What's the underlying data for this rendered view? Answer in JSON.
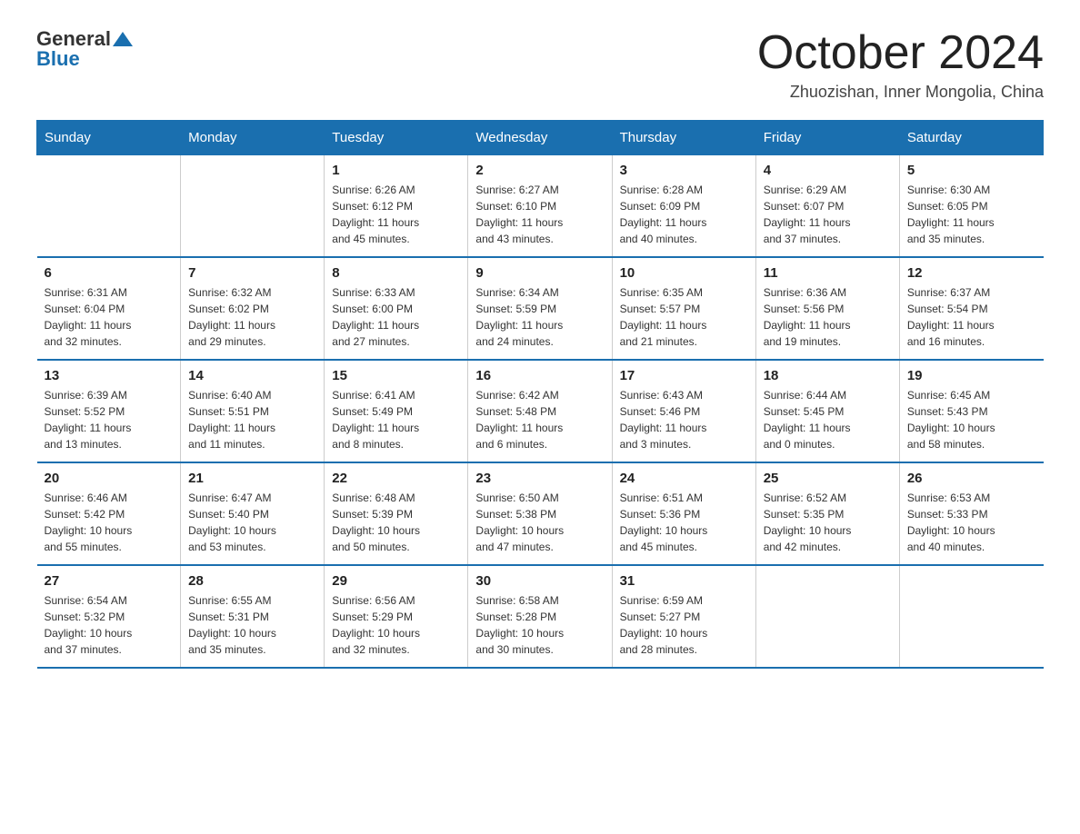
{
  "logo": {
    "general": "General",
    "blue": "Blue"
  },
  "header": {
    "month_year": "October 2024",
    "location": "Zhuozishan, Inner Mongolia, China"
  },
  "days_of_week": [
    "Sunday",
    "Monday",
    "Tuesday",
    "Wednesday",
    "Thursday",
    "Friday",
    "Saturday"
  ],
  "weeks": [
    [
      {
        "day": "",
        "info": ""
      },
      {
        "day": "",
        "info": ""
      },
      {
        "day": "1",
        "info": "Sunrise: 6:26 AM\nSunset: 6:12 PM\nDaylight: 11 hours\nand 45 minutes."
      },
      {
        "day": "2",
        "info": "Sunrise: 6:27 AM\nSunset: 6:10 PM\nDaylight: 11 hours\nand 43 minutes."
      },
      {
        "day": "3",
        "info": "Sunrise: 6:28 AM\nSunset: 6:09 PM\nDaylight: 11 hours\nand 40 minutes."
      },
      {
        "day": "4",
        "info": "Sunrise: 6:29 AM\nSunset: 6:07 PM\nDaylight: 11 hours\nand 37 minutes."
      },
      {
        "day": "5",
        "info": "Sunrise: 6:30 AM\nSunset: 6:05 PM\nDaylight: 11 hours\nand 35 minutes."
      }
    ],
    [
      {
        "day": "6",
        "info": "Sunrise: 6:31 AM\nSunset: 6:04 PM\nDaylight: 11 hours\nand 32 minutes."
      },
      {
        "day": "7",
        "info": "Sunrise: 6:32 AM\nSunset: 6:02 PM\nDaylight: 11 hours\nand 29 minutes."
      },
      {
        "day": "8",
        "info": "Sunrise: 6:33 AM\nSunset: 6:00 PM\nDaylight: 11 hours\nand 27 minutes."
      },
      {
        "day": "9",
        "info": "Sunrise: 6:34 AM\nSunset: 5:59 PM\nDaylight: 11 hours\nand 24 minutes."
      },
      {
        "day": "10",
        "info": "Sunrise: 6:35 AM\nSunset: 5:57 PM\nDaylight: 11 hours\nand 21 minutes."
      },
      {
        "day": "11",
        "info": "Sunrise: 6:36 AM\nSunset: 5:56 PM\nDaylight: 11 hours\nand 19 minutes."
      },
      {
        "day": "12",
        "info": "Sunrise: 6:37 AM\nSunset: 5:54 PM\nDaylight: 11 hours\nand 16 minutes."
      }
    ],
    [
      {
        "day": "13",
        "info": "Sunrise: 6:39 AM\nSunset: 5:52 PM\nDaylight: 11 hours\nand 13 minutes."
      },
      {
        "day": "14",
        "info": "Sunrise: 6:40 AM\nSunset: 5:51 PM\nDaylight: 11 hours\nand 11 minutes."
      },
      {
        "day": "15",
        "info": "Sunrise: 6:41 AM\nSunset: 5:49 PM\nDaylight: 11 hours\nand 8 minutes."
      },
      {
        "day": "16",
        "info": "Sunrise: 6:42 AM\nSunset: 5:48 PM\nDaylight: 11 hours\nand 6 minutes."
      },
      {
        "day": "17",
        "info": "Sunrise: 6:43 AM\nSunset: 5:46 PM\nDaylight: 11 hours\nand 3 minutes."
      },
      {
        "day": "18",
        "info": "Sunrise: 6:44 AM\nSunset: 5:45 PM\nDaylight: 11 hours\nand 0 minutes."
      },
      {
        "day": "19",
        "info": "Sunrise: 6:45 AM\nSunset: 5:43 PM\nDaylight: 10 hours\nand 58 minutes."
      }
    ],
    [
      {
        "day": "20",
        "info": "Sunrise: 6:46 AM\nSunset: 5:42 PM\nDaylight: 10 hours\nand 55 minutes."
      },
      {
        "day": "21",
        "info": "Sunrise: 6:47 AM\nSunset: 5:40 PM\nDaylight: 10 hours\nand 53 minutes."
      },
      {
        "day": "22",
        "info": "Sunrise: 6:48 AM\nSunset: 5:39 PM\nDaylight: 10 hours\nand 50 minutes."
      },
      {
        "day": "23",
        "info": "Sunrise: 6:50 AM\nSunset: 5:38 PM\nDaylight: 10 hours\nand 47 minutes."
      },
      {
        "day": "24",
        "info": "Sunrise: 6:51 AM\nSunset: 5:36 PM\nDaylight: 10 hours\nand 45 minutes."
      },
      {
        "day": "25",
        "info": "Sunrise: 6:52 AM\nSunset: 5:35 PM\nDaylight: 10 hours\nand 42 minutes."
      },
      {
        "day": "26",
        "info": "Sunrise: 6:53 AM\nSunset: 5:33 PM\nDaylight: 10 hours\nand 40 minutes."
      }
    ],
    [
      {
        "day": "27",
        "info": "Sunrise: 6:54 AM\nSunset: 5:32 PM\nDaylight: 10 hours\nand 37 minutes."
      },
      {
        "day": "28",
        "info": "Sunrise: 6:55 AM\nSunset: 5:31 PM\nDaylight: 10 hours\nand 35 minutes."
      },
      {
        "day": "29",
        "info": "Sunrise: 6:56 AM\nSunset: 5:29 PM\nDaylight: 10 hours\nand 32 minutes."
      },
      {
        "day": "30",
        "info": "Sunrise: 6:58 AM\nSunset: 5:28 PM\nDaylight: 10 hours\nand 30 minutes."
      },
      {
        "day": "31",
        "info": "Sunrise: 6:59 AM\nSunset: 5:27 PM\nDaylight: 10 hours\nand 28 minutes."
      },
      {
        "day": "",
        "info": ""
      },
      {
        "day": "",
        "info": ""
      }
    ]
  ]
}
